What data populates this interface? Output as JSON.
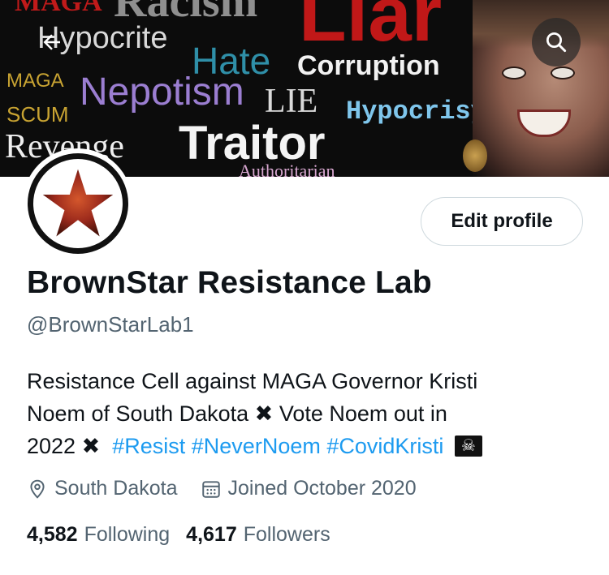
{
  "banner": {
    "words": [
      {
        "text": "MAGA",
        "color": "#c01a1a"
      },
      {
        "text": "Racism",
        "color": "#8f8f8f"
      },
      {
        "text": "Liar",
        "color": "#c11818"
      },
      {
        "text": "Hypocrite",
        "color": "#d9d9d9"
      },
      {
        "text": "Hate",
        "color": "#2f8fa8"
      },
      {
        "text": "Corruption",
        "color": "#f2f2f2"
      },
      {
        "text": "MAGA",
        "color": "#c8a332"
      },
      {
        "text": "Nepotism",
        "color": "#9b7ed1"
      },
      {
        "text": "LIE",
        "color": "#d9d9d9"
      },
      {
        "text": "Hypocrisy",
        "color": "#7fc6ec"
      },
      {
        "text": "SCUM",
        "color": "#c8a332"
      },
      {
        "text": "Revenge",
        "color": "#eeeeee"
      },
      {
        "text": "Traitor",
        "color": "#f4f4f4"
      },
      {
        "text": "Authoritarian",
        "color": "#d8a7d0"
      }
    ]
  },
  "nav": {
    "back_icon": "arrow-left-icon",
    "search_icon": "search-icon"
  },
  "profile": {
    "edit_label": "Edit profile",
    "name": "BrownStar Resistance Lab",
    "handle": "@BrownStarLab1",
    "bio": {
      "line1": "Resistance Cell against MAGA Governor Kristi",
      "line2a": "Noem of South Dakota",
      "x_mark": "✖",
      "line2b": "Vote Noem out in",
      "line3a": "2022",
      "tags": [
        "#Resist",
        "#NeverNoem",
        "#CovidKristi"
      ]
    },
    "location": "South Dakota",
    "joined": "Joined October 2020",
    "following_count": "4,582",
    "following_label": "Following",
    "followers_count": "4,617",
    "followers_label": "Followers"
  },
  "colors": {
    "accent": "#1d9bf0",
    "muted": "#536471",
    "avatar_star": "#9c2a1c"
  }
}
